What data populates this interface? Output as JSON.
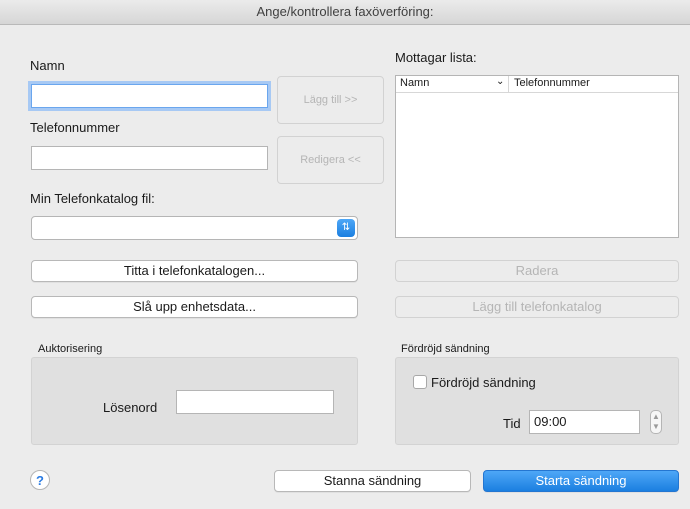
{
  "window": {
    "title": "Ange/kontrollera faxöverföring:"
  },
  "form": {
    "name_label": "Namn",
    "name_value": "",
    "phone_label": "Telefonnummer",
    "phone_value": "",
    "add_button": "Lägg till >>",
    "edit_button": "Redigera <<",
    "phonebook_label": "Min Telefonkatalog fil:",
    "phonebook_selected": ""
  },
  "recipients": {
    "label": "Mottagar lista:",
    "columns": [
      "Namn",
      "Telefonnummer"
    ],
    "sort_indicator": "⌄",
    "rows": []
  },
  "buttons": {
    "view_phonebook": "Titta i telefonkatalogen...",
    "lookup_device": "Slå upp enhetsdata...",
    "delete": "Radera",
    "add_to_phonebook": "Lägg till telefonkatalog",
    "stop": "Stanna sändning",
    "start": "Starta sändning",
    "help": "?"
  },
  "auth": {
    "title": "Auktorisering",
    "password_label": "Lösenord",
    "password_value": ""
  },
  "delayed": {
    "title": "Fördröjd sändning",
    "checkbox_label": "Fördröjd sändning",
    "checked": false,
    "time_label": "Tid",
    "time_value": "09:00"
  },
  "colors": {
    "accent": "#1b7fe0",
    "focus_ring": "#a7c9f4"
  }
}
